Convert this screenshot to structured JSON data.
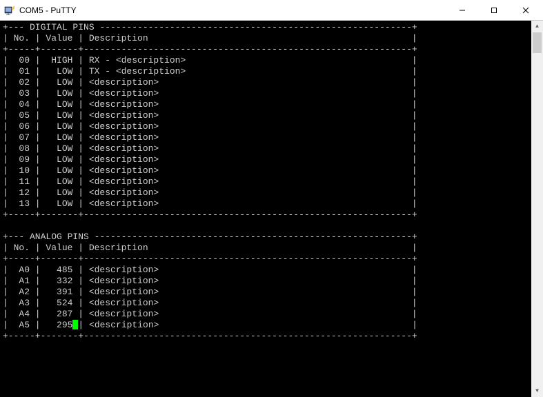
{
  "window": {
    "title": "COM5 - PuTTY"
  },
  "sections": [
    {
      "title": "DIGITAL PINS",
      "header": {
        "c1": "No.",
        "c2": "Value",
        "c3": "Description"
      },
      "rows": [
        {
          "no": "00",
          "val": "HIGH",
          "desc": "RX - <description>"
        },
        {
          "no": "01",
          "val": "LOW",
          "desc": "TX - <description>"
        },
        {
          "no": "02",
          "val": "LOW",
          "desc": "<description>"
        },
        {
          "no": "03",
          "val": "LOW",
          "desc": "<description>"
        },
        {
          "no": "04",
          "val": "LOW",
          "desc": "<description>"
        },
        {
          "no": "05",
          "val": "LOW",
          "desc": "<description>"
        },
        {
          "no": "06",
          "val": "LOW",
          "desc": "<description>"
        },
        {
          "no": "07",
          "val": "LOW",
          "desc": "<description>"
        },
        {
          "no": "08",
          "val": "LOW",
          "desc": "<description>"
        },
        {
          "no": "09",
          "val": "LOW",
          "desc": "<description>"
        },
        {
          "no": "10",
          "val": "LOW",
          "desc": "<description>"
        },
        {
          "no": "11",
          "val": "LOW",
          "desc": "<description>"
        },
        {
          "no": "12",
          "val": "LOW",
          "desc": "<description>"
        },
        {
          "no": "13",
          "val": "LOW",
          "desc": "<description>"
        }
      ]
    },
    {
      "title": "ANALOG PINS",
      "header": {
        "c1": "No.",
        "c2": "Value",
        "c3": "Description"
      },
      "rows": [
        {
          "no": "A0",
          "val": "485",
          "desc": "<description>"
        },
        {
          "no": "A1",
          "val": "332",
          "desc": "<description>"
        },
        {
          "no": "A2",
          "val": "391",
          "desc": "<description>"
        },
        {
          "no": "A3",
          "val": "524",
          "desc": "<description>"
        },
        {
          "no": "A4",
          "val": "287",
          "desc": "<description>"
        },
        {
          "no": "A5",
          "val": "295",
          "desc": "<description>",
          "cursor": true
        }
      ]
    }
  ],
  "layout": {
    "totalWidth": 77,
    "col1Width": 5,
    "col2Width": 7,
    "descWidth": 61
  }
}
